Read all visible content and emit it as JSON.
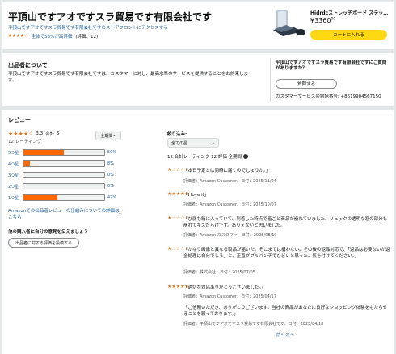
{
  "header": {
    "title": "平頂山ですアオですスラ貿易です有限会社です",
    "storefront_link": "平頂山ですアオですスラ貿易です有限会社ですのストアフロントにアクセスする",
    "stars": "★★★★☆",
    "positive_text": "全体で58%が高評価",
    "rating_count_text": "(評価：12)",
    "product": {
      "title": "Hidrdcストレッチボード ステッ…",
      "price": "¥3360",
      "price_sup": "00",
      "cart_button": "カートに入れる"
    }
  },
  "seller": {
    "section_title": "出品者について",
    "description": "平頂山ですアオですスラ貿易です有限会社ですは、カスタマーに対し、最高水準のサービスを提供することをお約束します。",
    "question": "平頂山ですアオですスラ貿易です有限会社ですにご質問がありますか？",
    "ask_button": "質問する",
    "phone_text": "カスタマーサービスの電話番号: +8619904567150"
  },
  "reviews": {
    "section_title": "レビュー",
    "summary_stars": "★★★★☆",
    "average": "3.3",
    "total_label": "合計",
    "total": "5",
    "count_text": "12 レーティング",
    "period_select": "全期間",
    "histogram": [
      {
        "label": "5つ星",
        "pct": 50,
        "pct_text": "50%"
      },
      {
        "label": "4つ星",
        "pct": 8,
        "pct_text": "8%"
      },
      {
        "label": "3つ星",
        "pct": 0,
        "pct_text": "0%"
      },
      {
        "label": "2つ星",
        "pct": 0,
        "pct_text": "0%"
      },
      {
        "label": "1つ星",
        "pct": 42,
        "pct_text": "42%"
      }
    ],
    "how_link": "Amazonでの出品者レビューの仕組みについての詳細はこちら",
    "share_title": "他の購入者に自分の意見を伝えましょう",
    "write_button": "出品者に対する評価を投稿する",
    "filter_label": "絞り込み:",
    "filter_select": "全ての星",
    "filter_summary": "12 合計レーティング 12 評価 全期間",
    "items": [
      {
        "stars": "★",
        "empty": "☆☆☆☆",
        "text": "「本日予定とは同時に届くのでしょうか。」",
        "meta": "評価者：Amazon Customer、日付：2025/11/04"
      },
      {
        "stars": "★★★★★",
        "empty": "",
        "text": "「I love it」",
        "meta": "評価者：Amazon Customer、日付：2025/10/07"
      },
      {
        "stars": "★",
        "empty": "☆☆☆☆",
        "text": "「ひ弱な箱に入っていて、到着した時点で箱ごと商品が崩れていました。リュックの透明な窓の部分も崩れてキズだらけです。ありえないと思いました。」",
        "meta": "評価者：Amazon カスタマー、日付：2025/08/19"
      },
      {
        "stars": "★",
        "empty": "☆☆☆☆",
        "text": "「かなり画像と異なる製品が届いた。そこまでは構わない。その後の返品対応で、「返品は必要ないが返金処理は自分でしろ」と、正直ダブルパンチでひどいと思った。気を付けてください。」",
        "meta": "評価者：株式会社、日付：2025/07/05"
      },
      {
        "stars": "★★★★★",
        "empty": "",
        "text": "「適切な対応ありがとうございました。」",
        "meta": "評価者：Amazon Customer、日付：2025/04/17"
      }
    ],
    "response": {
      "text": "「ご信頼いただき、ありがとうございます。当社の商品があなたに良好なショッピング体験をもたらせることを願っております。」",
      "meta": "評価者：平頂山ですアオですスラ貿易です有限会社です、日付：2025/04/18"
    },
    "pager": "前へ 次へ"
  },
  "colors": {
    "star": "#de7921",
    "bar": "#ff6800",
    "link": "#2162a1",
    "cart": "#ffd814"
  }
}
